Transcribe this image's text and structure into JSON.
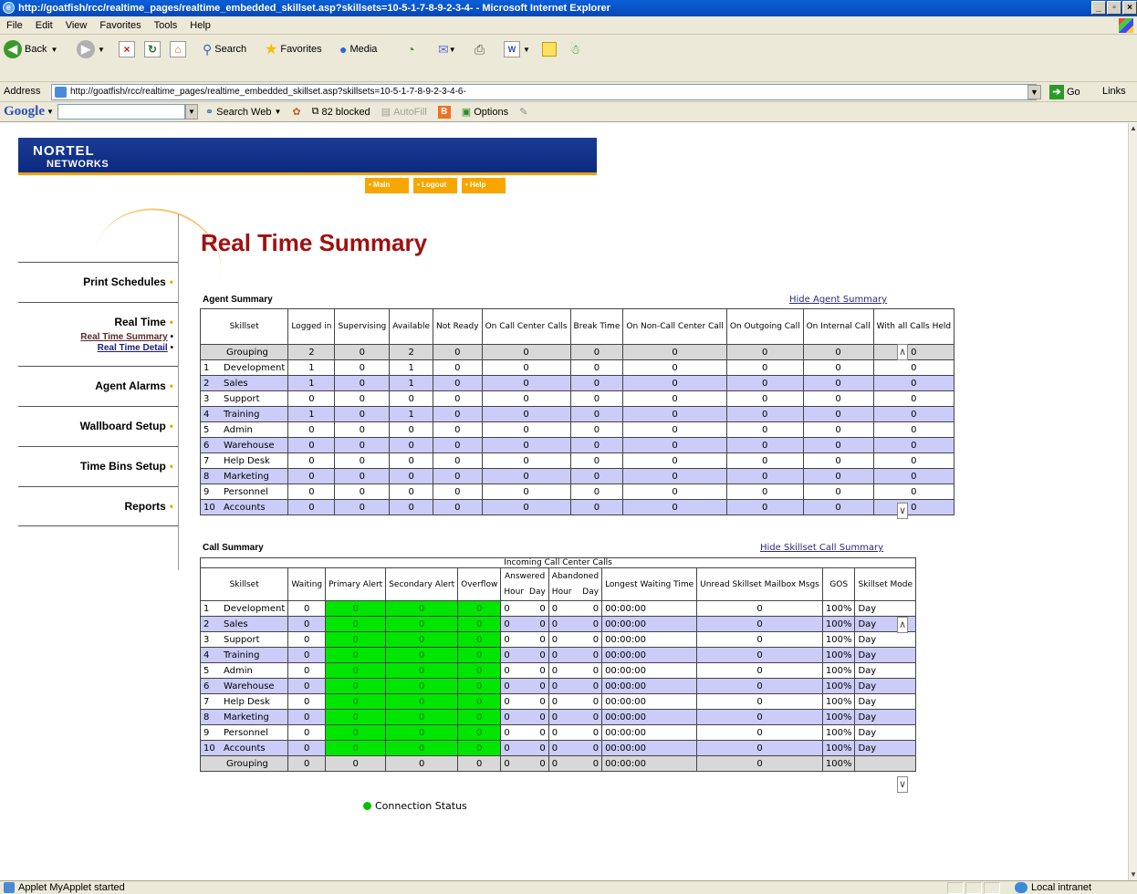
{
  "window": {
    "title": "http://goatfish/rcc/realtime_pages/realtime_embedded_skillset.asp?skillsets=10-5-1-7-8-9-2-3-4- - Microsoft Internet Explorer",
    "buttons": [
      "_",
      "▫",
      "×"
    ]
  },
  "menubar": [
    "File",
    "Edit",
    "View",
    "Favorites",
    "Tools",
    "Help"
  ],
  "toolbar": {
    "back": "Back",
    "search": "Search",
    "favorites": "Favorites",
    "media": "Media"
  },
  "address": {
    "label": "Address",
    "url": "http://goatfish/rcc/realtime_pages/realtime_embedded_skillset.asp?skillsets=10-5-1-7-8-9-2-3-4-6-",
    "go": "Go",
    "links": "Links"
  },
  "googlebar": {
    "logo": "Google",
    "search_web": "Search Web",
    "blocked": "82 blocked",
    "autofill": "AutoFill",
    "options": "Options"
  },
  "header": {
    "logo_line1": "NORTEL",
    "logo_line2": "NETWORKS",
    "nav": [
      "• Main",
      "• Logout",
      "• Help"
    ]
  },
  "sidebar": {
    "items": [
      {
        "label": "Print Schedules"
      },
      {
        "label": "Real Time"
      },
      {
        "label": "Agent Alarms"
      },
      {
        "label": "Wallboard Setup"
      },
      {
        "label": "Time Bins Setup"
      },
      {
        "label": "Reports"
      }
    ],
    "subitems": [
      "Real Time Summary",
      "Real Time Detail"
    ]
  },
  "page": {
    "title": "Real Time Summary"
  },
  "agent_summary": {
    "title": "Agent Summary",
    "hide_link": "Hide Agent Summary",
    "headers": [
      "Skillset",
      "Logged in",
      "Supervising",
      "Available",
      "Not Ready",
      "On Call Center Calls",
      "Break Time",
      "On Non-Call Center Call",
      "On Outgoing Call",
      "On Internal Call",
      "With all Calls Held"
    ],
    "grouping": {
      "name": "Grouping",
      "values": [
        "2",
        "0",
        "2",
        "0",
        "0",
        "0",
        "0",
        "0",
        "0",
        "0"
      ]
    },
    "rows": [
      {
        "num": "1",
        "name": "Development",
        "values": [
          "1",
          "0",
          "1",
          "0",
          "0",
          "0",
          "0",
          "0",
          "0",
          "0"
        ]
      },
      {
        "num": "2",
        "name": "Sales",
        "values": [
          "1",
          "0",
          "1",
          "0",
          "0",
          "0",
          "0",
          "0",
          "0",
          "0"
        ]
      },
      {
        "num": "3",
        "name": "Support",
        "values": [
          "0",
          "0",
          "0",
          "0",
          "0",
          "0",
          "0",
          "0",
          "0",
          "0"
        ]
      },
      {
        "num": "4",
        "name": "Training",
        "values": [
          "1",
          "0",
          "1",
          "0",
          "0",
          "0",
          "0",
          "0",
          "0",
          "0"
        ]
      },
      {
        "num": "5",
        "name": "Admin",
        "values": [
          "0",
          "0",
          "0",
          "0",
          "0",
          "0",
          "0",
          "0",
          "0",
          "0"
        ]
      },
      {
        "num": "6",
        "name": "Warehouse",
        "values": [
          "0",
          "0",
          "0",
          "0",
          "0",
          "0",
          "0",
          "0",
          "0",
          "0"
        ]
      },
      {
        "num": "7",
        "name": "Help Desk",
        "values": [
          "0",
          "0",
          "0",
          "0",
          "0",
          "0",
          "0",
          "0",
          "0",
          "0"
        ]
      },
      {
        "num": "8",
        "name": "Marketing",
        "values": [
          "0",
          "0",
          "0",
          "0",
          "0",
          "0",
          "0",
          "0",
          "0",
          "0"
        ]
      },
      {
        "num": "9",
        "name": "Personnel",
        "values": [
          "0",
          "0",
          "0",
          "0",
          "0",
          "0",
          "0",
          "0",
          "0",
          "0"
        ]
      },
      {
        "num": "10",
        "name": "Accounts",
        "values": [
          "0",
          "0",
          "0",
          "0",
          "0",
          "0",
          "0",
          "0",
          "0",
          "0"
        ]
      }
    ]
  },
  "call_summary": {
    "title": "Call Summary",
    "hide_link": "Hide Skillset Call Summary",
    "group_header": "Incoming Call Center Calls",
    "headers": {
      "skillset": "Skillset",
      "waiting": "Waiting",
      "primary": "Primary Alert",
      "secondary": "Secondary Alert",
      "overflow": "Overflow",
      "answered": "Answered",
      "abandoned": "Abandoned",
      "hour": "Hour",
      "day": "Day",
      "longest": "Longest Waiting Time",
      "unread": "Unread Skillset Mailbox Msgs",
      "gos": "GOS",
      "mode": "Skillset Mode"
    },
    "rows": [
      {
        "num": "1",
        "name": "Development",
        "waiting": "0",
        "primary": "0",
        "secondary": "0",
        "overflow": "0",
        "ans_hour": "0",
        "ans_day": "0",
        "ab_hour": "0",
        "ab_day": "0",
        "longest": "00:00:00",
        "unread": "0",
        "gos": "100%",
        "mode": "Day"
      },
      {
        "num": "2",
        "name": "Sales",
        "waiting": "0",
        "primary": "0",
        "secondary": "0",
        "overflow": "0",
        "ans_hour": "0",
        "ans_day": "0",
        "ab_hour": "0",
        "ab_day": "0",
        "longest": "00:00:00",
        "unread": "0",
        "gos": "100%",
        "mode": "Day"
      },
      {
        "num": "3",
        "name": "Support",
        "waiting": "0",
        "primary": "0",
        "secondary": "0",
        "overflow": "0",
        "ans_hour": "0",
        "ans_day": "0",
        "ab_hour": "0",
        "ab_day": "0",
        "longest": "00:00:00",
        "unread": "0",
        "gos": "100%",
        "mode": "Day"
      },
      {
        "num": "4",
        "name": "Training",
        "waiting": "0",
        "primary": "0",
        "secondary": "0",
        "overflow": "0",
        "ans_hour": "0",
        "ans_day": "0",
        "ab_hour": "0",
        "ab_day": "0",
        "longest": "00:00:00",
        "unread": "0",
        "gos": "100%",
        "mode": "Day"
      },
      {
        "num": "5",
        "name": "Admin",
        "waiting": "0",
        "primary": "0",
        "secondary": "0",
        "overflow": "0",
        "ans_hour": "0",
        "ans_day": "0",
        "ab_hour": "0",
        "ab_day": "0",
        "longest": "00:00:00",
        "unread": "0",
        "gos": "100%",
        "mode": "Day"
      },
      {
        "num": "6",
        "name": "Warehouse",
        "waiting": "0",
        "primary": "0",
        "secondary": "0",
        "overflow": "0",
        "ans_hour": "0",
        "ans_day": "0",
        "ab_hour": "0",
        "ab_day": "0",
        "longest": "00:00:00",
        "unread": "0",
        "gos": "100%",
        "mode": "Day"
      },
      {
        "num": "7",
        "name": "Help Desk",
        "waiting": "0",
        "primary": "0",
        "secondary": "0",
        "overflow": "0",
        "ans_hour": "0",
        "ans_day": "0",
        "ab_hour": "0",
        "ab_day": "0",
        "longest": "00:00:00",
        "unread": "0",
        "gos": "100%",
        "mode": "Day"
      },
      {
        "num": "8",
        "name": "Marketing",
        "waiting": "0",
        "primary": "0",
        "secondary": "0",
        "overflow": "0",
        "ans_hour": "0",
        "ans_day": "0",
        "ab_hour": "0",
        "ab_day": "0",
        "longest": "00:00:00",
        "unread": "0",
        "gos": "100%",
        "mode": "Day"
      },
      {
        "num": "9",
        "name": "Personnel",
        "waiting": "0",
        "primary": "0",
        "secondary": "0",
        "overflow": "0",
        "ans_hour": "0",
        "ans_day": "0",
        "ab_hour": "0",
        "ab_day": "0",
        "longest": "00:00:00",
        "unread": "0",
        "gos": "100%",
        "mode": "Day"
      },
      {
        "num": "10",
        "name": "Accounts",
        "waiting": "0",
        "primary": "0",
        "secondary": "0",
        "overflow": "0",
        "ans_hour": "0",
        "ans_day": "0",
        "ab_hour": "0",
        "ab_day": "0",
        "longest": "00:00:00",
        "unread": "0",
        "gos": "100%",
        "mode": "Day"
      }
    ],
    "grouping": {
      "name": "Grouping",
      "waiting": "0",
      "primary": "0",
      "secondary": "0",
      "overflow": "0",
      "ans_hour": "0",
      "ans_day": "0",
      "ab_hour": "0",
      "ab_day": "0",
      "longest": "00:00:00",
      "unread": "0",
      "gos": "100%",
      "mode": ""
    }
  },
  "connection_status": "Connection Status",
  "status_bar": {
    "text": "Applet MyApplet started",
    "zone": "Local intranet"
  },
  "colors": {
    "accent_orange": "#f7a600",
    "header_blue": "#0c2a80",
    "title_red": "#a01010",
    "row_alt": "#ccccf8",
    "alert_green": "#00e600"
  }
}
